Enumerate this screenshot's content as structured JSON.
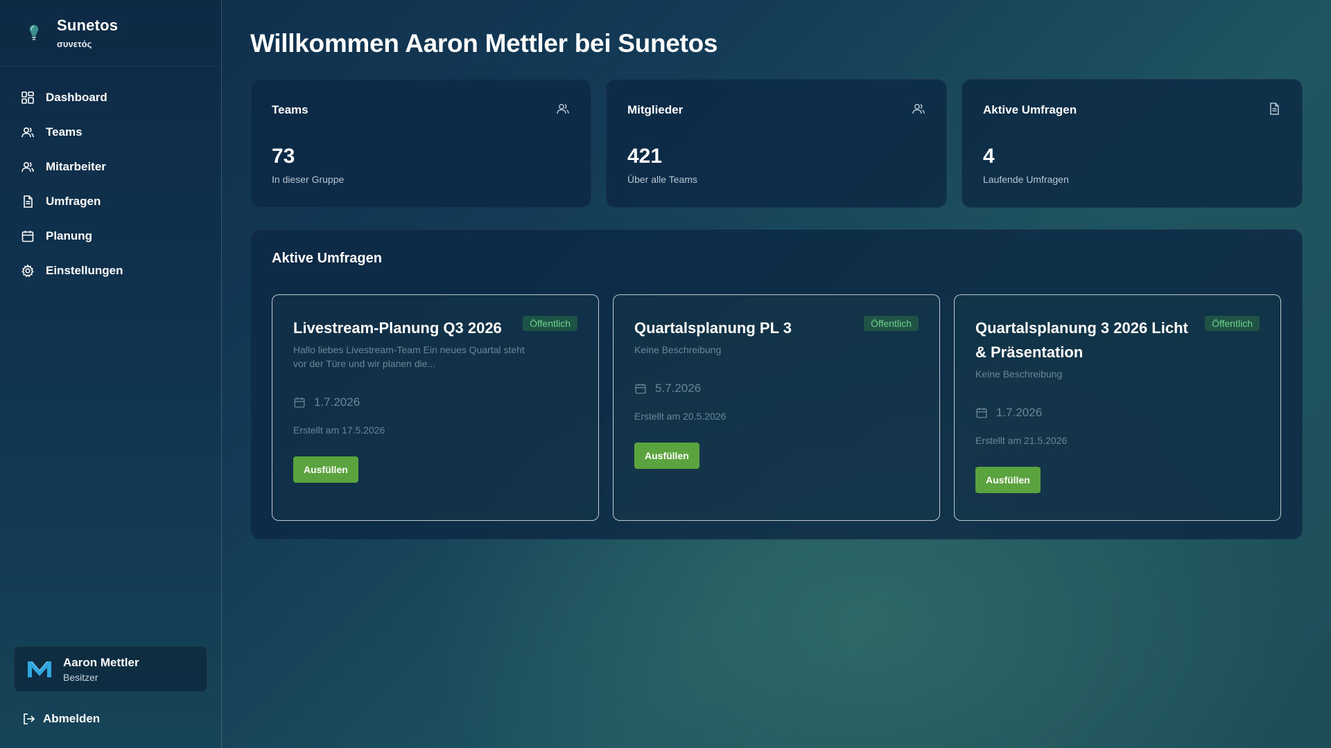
{
  "brand": {
    "name": "Sunetos",
    "subtitle": "συνετός"
  },
  "nav": [
    {
      "label": "Dashboard",
      "icon": "dashboard-grid-icon"
    },
    {
      "label": "Teams",
      "icon": "users-icon"
    },
    {
      "label": "Mitarbeiter",
      "icon": "users-icon"
    },
    {
      "label": "Umfragen",
      "icon": "document-icon"
    },
    {
      "label": "Planung",
      "icon": "calendar-icon"
    },
    {
      "label": "Einstellungen",
      "icon": "gear-icon"
    }
  ],
  "user": {
    "name": "Aaron Mettler",
    "role": "Besitzer"
  },
  "logout_label": "Abmelden",
  "page_title": "Willkommen Aaron Mettler bei Sunetos",
  "stats": [
    {
      "title": "Teams",
      "value": "73",
      "sub": "In dieser Gruppe",
      "icon": "users-icon"
    },
    {
      "title": "Mitglieder",
      "value": "421",
      "sub": "Über alle Teams",
      "icon": "users-icon"
    },
    {
      "title": "Aktive Umfragen",
      "value": "4",
      "sub": "Laufende Umfragen",
      "icon": "document-icon"
    }
  ],
  "active_surveys": {
    "title": "Aktive Umfragen",
    "items": [
      {
        "title": "Livestream-Planung Q3 2026",
        "badge": "Öffentlich",
        "description": "Hallo liebes Livestream-Team Ein neues Quartal steht vor der Türe und wir planen die...",
        "date": "1.7.2026",
        "created": "Erstellt am 17.5.2026",
        "button": "Ausfüllen"
      },
      {
        "title": "Quartalsplanung PL 3",
        "badge": "Öffentlich",
        "description": "Keine Beschreibung",
        "date": "5.7.2026",
        "created": "Erstellt am 20.5.2026",
        "button": "Ausfüllen"
      },
      {
        "title": "Quartalsplanung 3 2026 Licht & Präsentation",
        "badge": "Öffentlich",
        "description": "Keine Beschreibung",
        "date": "1.7.2026",
        "created": "Erstellt am 21.5.2026",
        "button": "Ausfüllen"
      }
    ]
  },
  "colors": {
    "accent_green": "#5ba33e",
    "badge_text": "#6fd38a",
    "card_bg": "#0c2642"
  }
}
